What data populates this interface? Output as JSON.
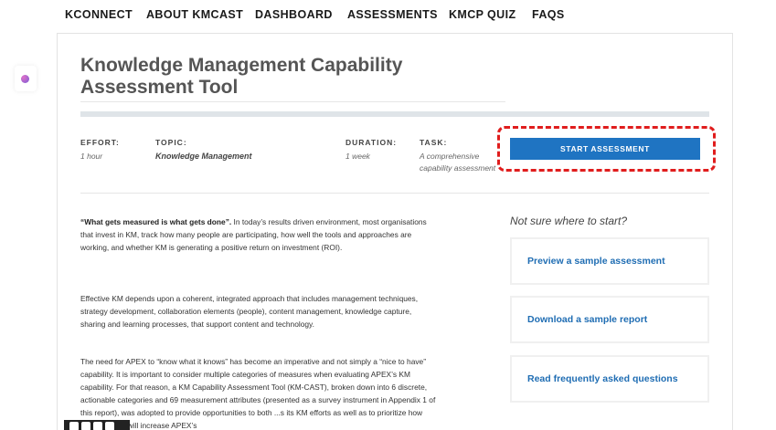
{
  "nav": {
    "items": [
      "KCONNECT",
      "ABOUT KMCAST",
      "DASHBOARD",
      "ASSESSMENTS",
      "KMCP QUIZ",
      "FAQS"
    ]
  },
  "page": {
    "title_line1": "Knowledge Management Capability",
    "title_line2": "Assessment Tool"
  },
  "meta": {
    "effort_label": "EFFORT:",
    "effort_value": "1 hour",
    "topic_label": "TOPIC:",
    "topic_value": "Knowledge Management",
    "duration_label": "DURATION:",
    "duration_value": "1 week",
    "task_label": "TASK:",
    "task_value_line1": "A comprehensive",
    "task_value_line2": "capability assessment"
  },
  "actions": {
    "start_label": "START ASSESSMENT"
  },
  "body": {
    "p1_bold": "“What gets measured is what gets done”.",
    "p1_rest": " In today’s results driven environment, most organisations that invest in KM, track how many people are participating, how well the tools and approaches are working, and whether KM is generating a positive return on investment (ROI).",
    "p2": "Effective KM depends upon a coherent, integrated approach that includes management techniques, strategy development, collaboration elements (people), content management, knowledge capture, sharing and learning processes, that support content and technology.",
    "p3": "The need for APEX to “know what it knows” has become an imperative and not simply a “nice to have” capability. It is important to consider multiple categories of measures when evaluating APEX’s KM capability. For that reason, a KM Capability Assessment Tool (KM-CAST), broken down into 6 discrete, actionable categories and 69 measurement attributes (presented as a survey instrument in Appendix 1 of this report), was adopted to provide opportunities to both ...s its KM efforts as well as to prioritize how those actions will increase APEX’s"
  },
  "sidebar": {
    "heading": "Not sure where to start?",
    "links": [
      "Preview a sample assessment",
      "Download a sample report",
      "Read frequently asked questions"
    ]
  }
}
